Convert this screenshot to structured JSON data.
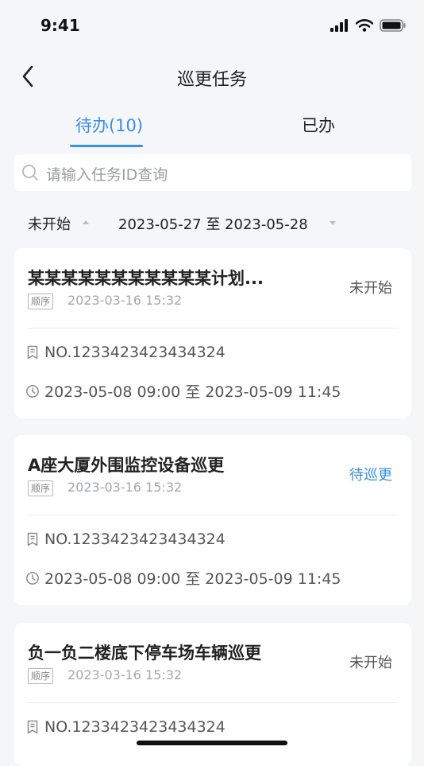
{
  "status_bar": {
    "time": "9:41"
  },
  "nav": {
    "title": "巡更任务"
  },
  "tabs": [
    {
      "label": "待办(10)",
      "active": true
    },
    {
      "label": "已办",
      "active": false
    }
  ],
  "search": {
    "placeholder": "请输入任务ID查询"
  },
  "filters": {
    "status": "未开始",
    "date_range": "2023-05-27 至 2023-05-28"
  },
  "tasks": [
    {
      "title": "某某某某某某某某某某某计划...",
      "status": "未开始",
      "tag": "顺序",
      "created": "2023-03-16 15:32",
      "number": "NO.1233423423434324",
      "time_range": "2023-05-08 09:00 至 2023-05-09 11:45"
    },
    {
      "title": "A座大厦外围监控设备巡更",
      "status": "待巡更",
      "tag": "顺序",
      "created": "2023-03-16 15:32",
      "number": "NO.1233423423434324",
      "time_range": "2023-05-08 09:00 至 2023-05-09 11:45"
    },
    {
      "title": "负一负二楼底下停车场车辆巡更",
      "status": "未开始",
      "tag": "顺序",
      "created": "2023-03-16 15:32",
      "number": "NO.1233423423434324",
      "time_range": ""
    }
  ],
  "colors": {
    "accent": "#3b8ee6",
    "background": "#f5f6f8"
  },
  "icons": [
    "back-arrow-icon",
    "search-icon",
    "caret-up-icon",
    "caret-down-icon",
    "document-icon",
    "clock-icon",
    "signal-icon",
    "wifi-icon",
    "battery-icon"
  ]
}
